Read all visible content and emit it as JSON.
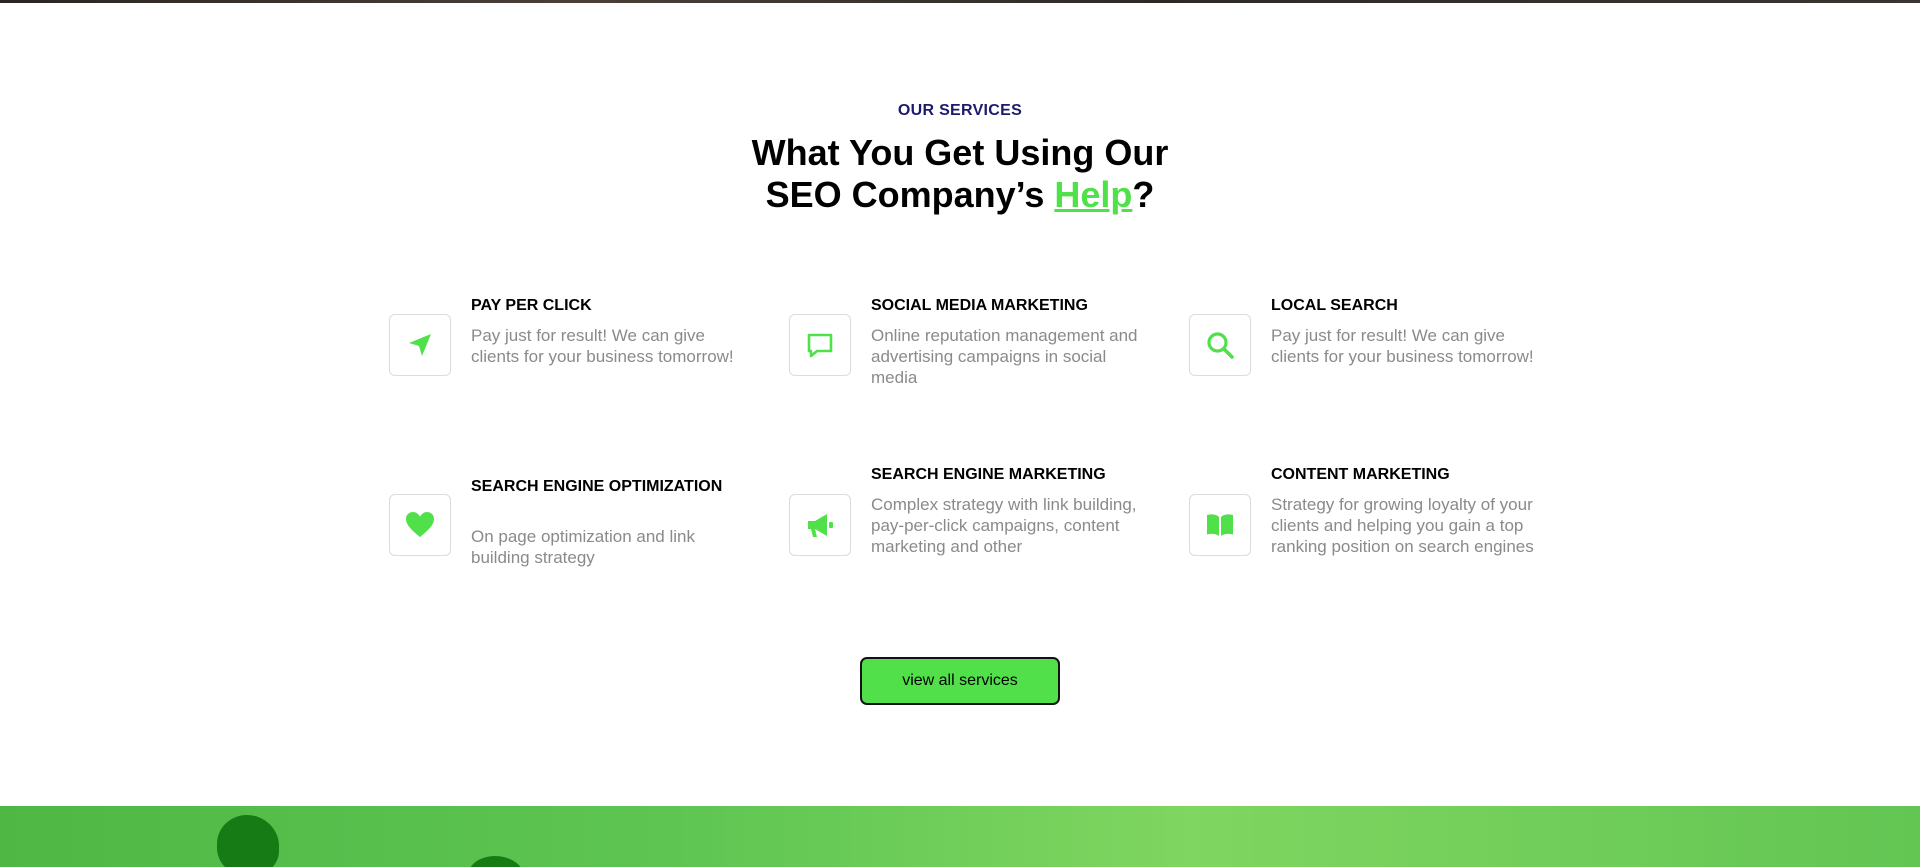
{
  "section": {
    "eyebrow": "OUR SERVICES",
    "heading_line1": "What You Get Using Our",
    "heading_line2_before": "SEO Company’s ",
    "heading_highlight": "Help",
    "heading_line2_after": "?"
  },
  "services": [
    {
      "title": "PAY PER CLICK",
      "description": "Pay just for result! We can give clients for your business tomorrow!",
      "icon": "paper-plane-icon"
    },
    {
      "title": "SOCIAL MEDIA MARKETING",
      "description": "Online reputation management and advertising campaigns in social media",
      "icon": "chat-bubble-icon"
    },
    {
      "title": "LOCAL SEARCH",
      "description": "Pay just for result! We can give clients for your business tomorrow!",
      "icon": "search-icon"
    },
    {
      "title": "SEARCH ENGINE OPTIMIZATION",
      "description": "On page optimization and link building strategy",
      "icon": "heart-icon"
    },
    {
      "title": "SEARCH ENGINE MARKETING",
      "description": "Complex strategy with link building, pay-per-click campaigns, content marketing and other",
      "icon": "megaphone-icon"
    },
    {
      "title": "CONTENT MARKETING",
      "description": "Strategy for growing loyalty of your clients and helping you gain a top ranking position on search engines",
      "icon": "open-book-icon"
    }
  ],
  "cta": {
    "label": "view all services"
  },
  "colors": {
    "accent": "#50e04a",
    "eyebrow": "#1d1a6e",
    "description_text": "#8a8a8a",
    "footer_band": "#5ec552"
  }
}
